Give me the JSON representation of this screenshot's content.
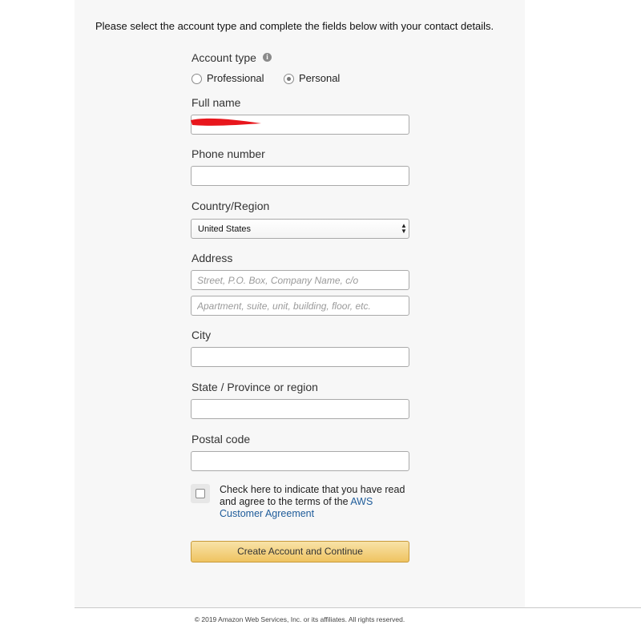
{
  "intro_text": "Please select the account type and complete the fields below with your contact details.",
  "account_type": {
    "label": "Account type",
    "options": [
      {
        "label": "Professional",
        "selected": false
      },
      {
        "label": "Personal",
        "selected": true
      }
    ]
  },
  "full_name": {
    "label": "Full name",
    "value": ""
  },
  "phone": {
    "label": "Phone number",
    "value": ""
  },
  "country": {
    "label": "Country/Region",
    "value": "United States"
  },
  "address": {
    "label": "Address",
    "line1_placeholder": "Street, P.O. Box, Company Name, c/o",
    "line2_placeholder": "Apartment, suite, unit, building, floor, etc."
  },
  "city": {
    "label": "City",
    "value": ""
  },
  "state": {
    "label": "State / Province or region",
    "value": ""
  },
  "postal": {
    "label": "Postal code",
    "value": ""
  },
  "agreement": {
    "text": "Check here to indicate that you have read and agree to the terms of the ",
    "link_text": "AWS Customer Agreement",
    "checked": false
  },
  "submit_label": "Create Account and Continue",
  "footer_text": "© 2019 Amazon Web Services, Inc. or its affiliates. All rights reserved.",
  "colors": {
    "link": "#1f5c9a",
    "button": "#efc361",
    "redaction": "#e8161c"
  }
}
